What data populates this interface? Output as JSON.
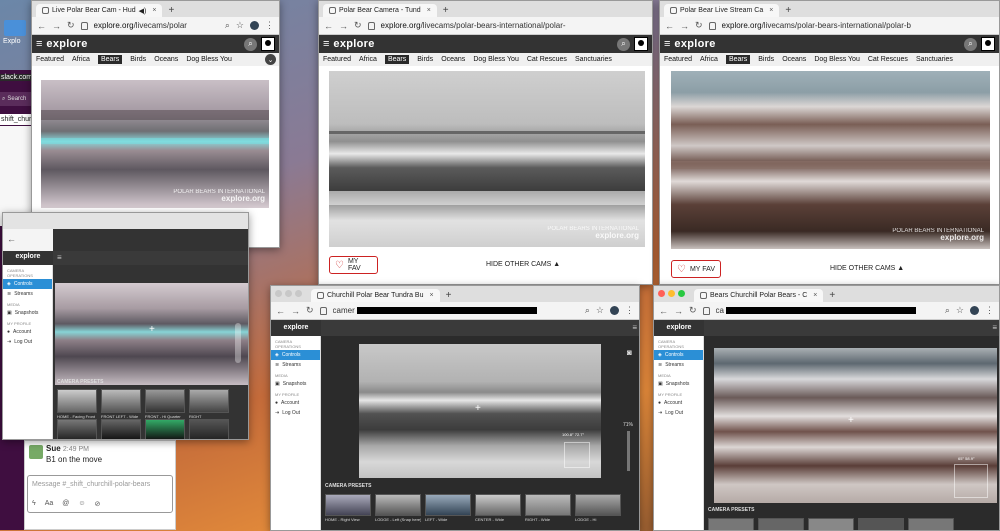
{
  "tabs": {
    "w1": "Live Polar Bear Cam - Hud",
    "w2": "Polar Bear Camera - Tund",
    "w3": "Polar Bear Live Stream Ca",
    "w5": "Churchill Polar Bear Tundra Bu",
    "w6": "Bears Churchill Polar Bears - C"
  },
  "urls": {
    "w1_host": "explore.org",
    "w1_path": "/livecams/polar",
    "w2_host": "explore.org",
    "w2_path": "/livecams/polar-bears-international/polar-",
    "w3_host": "explore.org",
    "w3_path": "/livecams/polar-bears-international/polar-b",
    "w5": "camer",
    "w6": "ca"
  },
  "explore": {
    "logo": "explore",
    "cats": [
      "Featured",
      "Africa",
      "Bears",
      "Birds",
      "Oceans",
      "Dog Bless You",
      "Cat Rescues",
      "Sanctuaries"
    ],
    "my_fav": "MY FAV",
    "hide_other_cams": "HIDE OTHER CAMS ▲",
    "wm_line1": "POLAR BEARS INTERNATIONAL",
    "wm_line2": "explore.org"
  },
  "console": {
    "logo": "explore",
    "section_cam_ops": "CAMERA OPERATIONS",
    "controls": "Controls",
    "streams": "Streams",
    "section_media": "MEDIA",
    "snapshots": "Snapshots",
    "section_profile": "MY PROFILE",
    "account": "Account",
    "logout": "Log Out",
    "presets_title": "CAMERA PRESETS",
    "presets_w4": [
      "HOME - Facing Front",
      "FRONT LEFT - Wide",
      "FRONT - Hi Quarter",
      "RIGHT"
    ],
    "presets_w5": [
      "HOME - Right View",
      "LODGE - Left (Snap here)",
      "LEFT - Wide",
      "CENTER - Wide",
      "RIGHT - Wide",
      "LODGE - Hi"
    ],
    "ptz_w5": "100.8°  72.7°",
    "zoom_w5": "71%",
    "ptz_w6": "65°  58.9°"
  },
  "slack": {
    "explore_label": "Explo",
    "host": "slack.com",
    "search": "Search",
    "channel": "shift_churchil",
    "sender": "Sue",
    "time": "2:49 PM",
    "message": "B1 on the move",
    "composer_placeholder": "Message #_shift_churchill-polar-bears",
    "toolbar": [
      "Aa",
      "@",
      "☺",
      "⊘"
    ]
  }
}
